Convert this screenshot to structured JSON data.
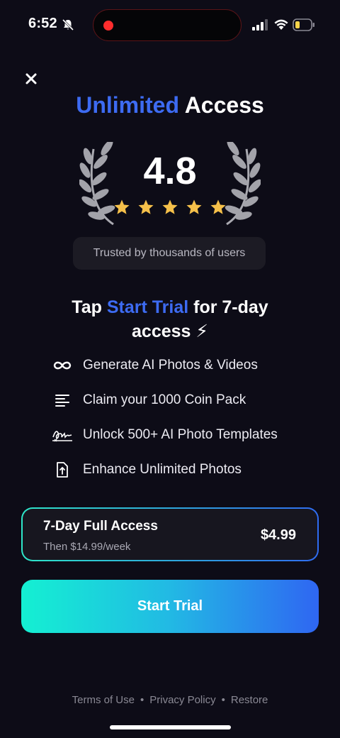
{
  "status_bar": {
    "time": "6:52",
    "icons": [
      "bell-slash-icon",
      "cellular-signal-icon",
      "wifi-icon",
      "battery-low-icon"
    ]
  },
  "header": {
    "close_icon": "close-icon",
    "title_accent": "Unlimited",
    "title_rest": "Access"
  },
  "rating": {
    "value": "4.8",
    "stars": 5,
    "trust_text": "Trusted by thousands of users"
  },
  "headline": {
    "prefix": "Tap ",
    "accent": "Start Trial",
    "suffix": " for 7-day access ⚡"
  },
  "features": [
    {
      "icon": "infinity-icon",
      "label": "Generate AI Photos & Videos"
    },
    {
      "icon": "lines-icon",
      "label": "Claim your 1000 Coin Pack"
    },
    {
      "icon": "signature-icon",
      "label": "Unlock 500+ AI Photo Templates"
    },
    {
      "icon": "enhance-file-icon",
      "label": "Enhance Unlimited Photos"
    }
  ],
  "plan": {
    "name": "7-Day Full Access",
    "subtext": "Then $14.99/week",
    "price": "$4.99"
  },
  "cta": {
    "label": "Start Trial"
  },
  "footer": {
    "terms": "Terms of Use",
    "privacy": "Privacy Policy",
    "restore": "Restore",
    "separator": "•"
  },
  "colors": {
    "background": "#0d0c17",
    "accent_blue": "#3d6bf2",
    "star_gold": "#f5c04a",
    "gradient_start": "#14f0d2",
    "gradient_end": "#2f66f2"
  }
}
